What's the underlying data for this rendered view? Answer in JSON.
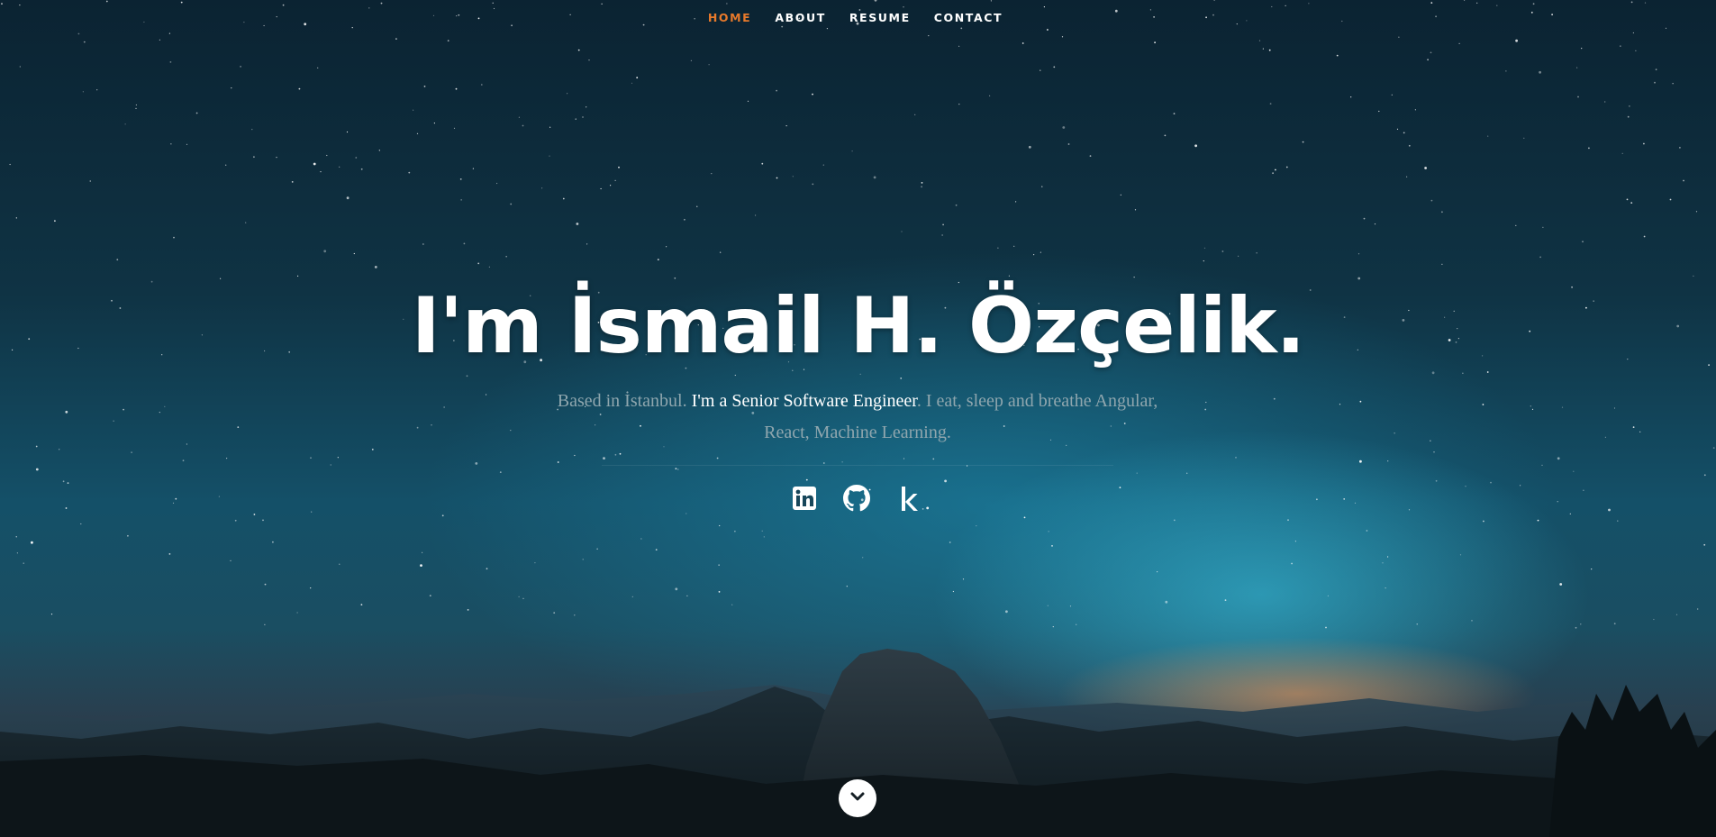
{
  "nav": {
    "items": [
      {
        "label": "HOME",
        "active": true
      },
      {
        "label": "ABOUT",
        "active": false
      },
      {
        "label": "RESUME",
        "active": false
      },
      {
        "label": "CONTACT",
        "active": false
      }
    ]
  },
  "hero": {
    "headline": "I'm İsmail H. Özçelik.",
    "intro_prefix": "Based in İstanbul. ",
    "intro_highlight": "I'm a Senior Software Engineer",
    "intro_suffix": ". I eat, sleep and breathe Angular, React, Machine Learning."
  },
  "social": {
    "items": [
      {
        "name": "linkedin-icon",
        "glyph": "in"
      },
      {
        "name": "github-icon",
        "glyph": ""
      },
      {
        "name": "kaggle-icon",
        "glyph": "k"
      }
    ]
  },
  "scroll": {
    "icon": "chevron-down-icon"
  },
  "colors": {
    "accent": "#e7792b",
    "text": "#ffffff",
    "muted": "#8fa6ae"
  }
}
